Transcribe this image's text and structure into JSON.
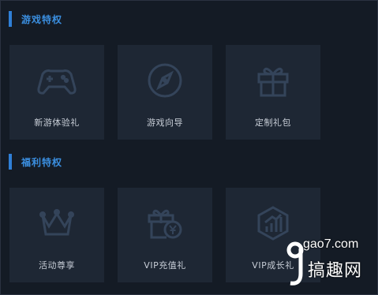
{
  "sections": [
    {
      "title": "游戏特权",
      "cards": [
        {
          "label": "新游体验礼",
          "icon": "gamepad-icon"
        },
        {
          "label": "游戏向导",
          "icon": "compass-icon"
        },
        {
          "label": "定制礼包",
          "icon": "gift-box-icon"
        }
      ]
    },
    {
      "title": "福利特权",
      "cards": [
        {
          "label": "活动尊享",
          "icon": "crown-icon"
        },
        {
          "label": "VIP充值礼",
          "icon": "gift-yuan-icon"
        },
        {
          "label": "VIP成长礼",
          "icon": "growth-chart-icon"
        }
      ]
    }
  ],
  "watermark": {
    "domain": "gao7.com",
    "brand": "搞趣网"
  },
  "colors": {
    "panel_bg": "#141b25",
    "card_bg": "#1e2734",
    "accent": "#2f7fd6",
    "icon": "#34445a"
  }
}
